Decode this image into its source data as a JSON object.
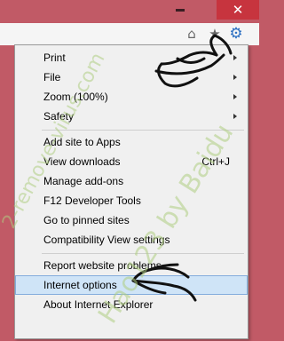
{
  "window": {
    "close_glyph": "✕"
  },
  "toolbar": {
    "home_glyph": "⌂",
    "favorites_glyph": "★",
    "tools_glyph": "⚙"
  },
  "menu": {
    "items": [
      {
        "label": "Print",
        "submenu": true
      },
      {
        "label": "File",
        "submenu": true
      },
      {
        "label": "Zoom (100%)",
        "submenu": true
      },
      {
        "label": "Safety",
        "submenu": true
      },
      {
        "label": "Add site to Apps"
      },
      {
        "label": "View downloads",
        "shortcut": "Ctrl+J"
      },
      {
        "label": "Manage add-ons"
      },
      {
        "label": "F12 Developer Tools"
      },
      {
        "label": "Go to pinned sites"
      },
      {
        "label": "Compatibility View settings"
      },
      {
        "label": "Report website problems"
      },
      {
        "label": "Internet options",
        "highlighted": true
      },
      {
        "label": "About Internet Explorer"
      }
    ]
  },
  "watermark": {
    "text1": "2-remove-virus.com",
    "text2": "Hao123 by Baidu"
  },
  "colors": {
    "titlebar": "#c15a66",
    "close_button": "#c7343e",
    "menu_bg": "#f0f0f0",
    "highlight_bg": "#cfe4f7",
    "highlight_border": "#84acdd",
    "watermark": "#afcd82",
    "gear_icon": "#2b6fc2"
  }
}
